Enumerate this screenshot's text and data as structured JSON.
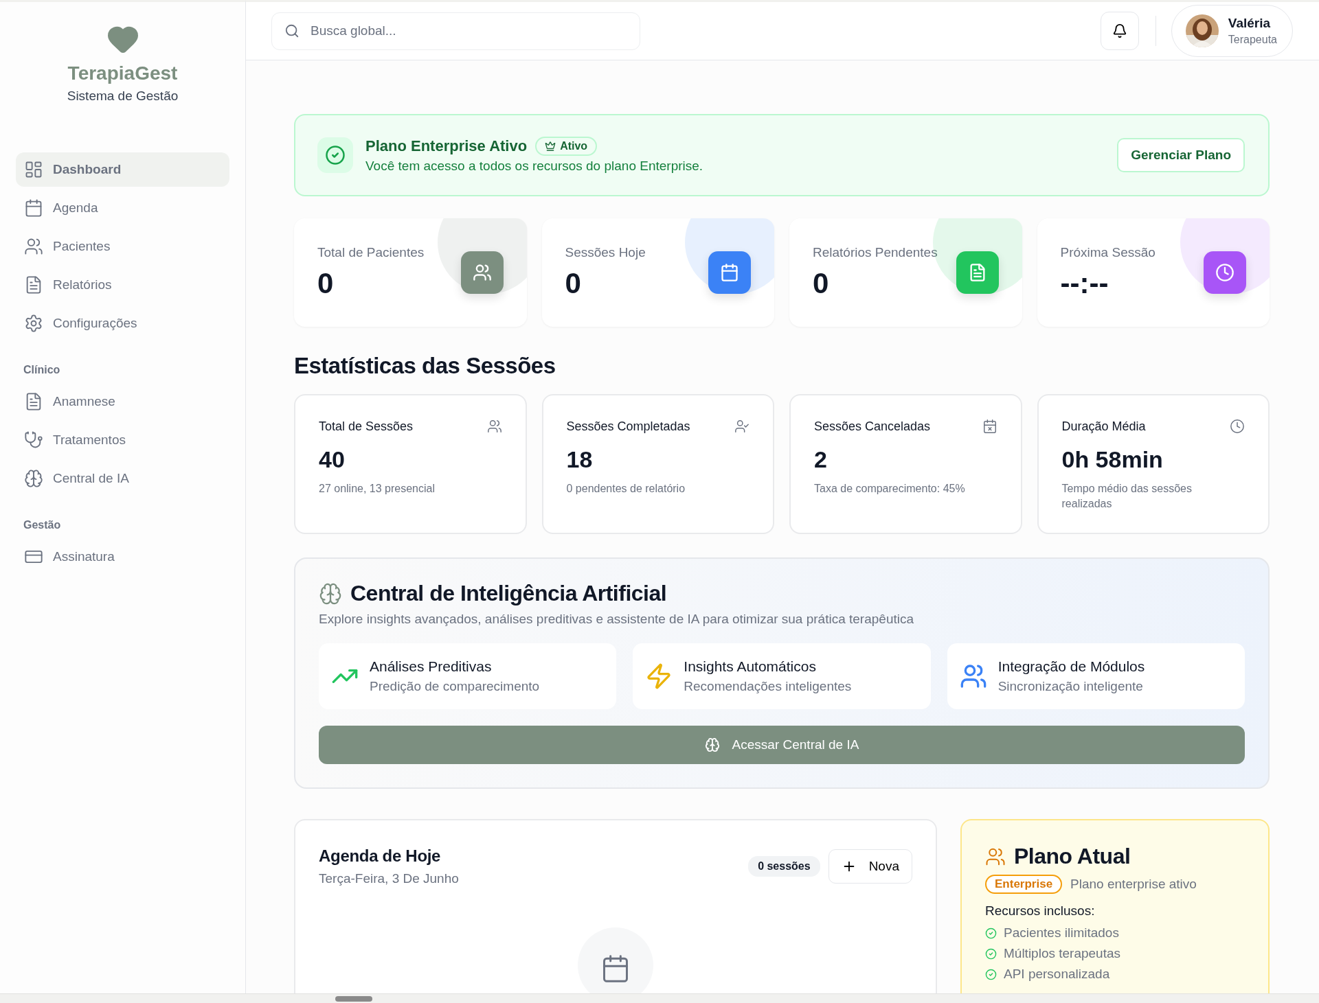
{
  "sidebar": {
    "brand": "TerapiaGest",
    "tagline": "Sistema de Gestão",
    "items": [
      {
        "label": "Dashboard",
        "selected": true
      },
      {
        "label": "Agenda",
        "selected": false
      },
      {
        "label": "Pacientes",
        "selected": false
      },
      {
        "label": "Relatórios",
        "selected": false
      },
      {
        "label": "Configurações",
        "selected": false
      }
    ],
    "sections": [
      {
        "title": "Clínico",
        "items": [
          {
            "label": "Anamnese",
            "selected": false
          },
          {
            "label": "Tratamentos",
            "selected": false
          },
          {
            "label": "Central de IA",
            "selected": false
          }
        ]
      },
      {
        "title": "Gestão",
        "items": [
          {
            "label": "Assinatura",
            "selected": false
          }
        ]
      }
    ]
  },
  "header": {
    "search": {
      "placeholder": "Busca global..."
    },
    "user": {
      "name": "Valéria",
      "role": "Terapeuta"
    }
  },
  "banner": {
    "title": "Plano Enterprise Ativo",
    "badge": "Ativo",
    "text": "Você tem acesso a todos os recursos do plano Enterprise.",
    "button": "Gerenciar Plano"
  },
  "stats": [
    {
      "label": "Total de Pacientes",
      "value": "0",
      "color": "#7c8f80"
    },
    {
      "label": "Sessões Hoje",
      "value": "0",
      "color": "#3b82f6"
    },
    {
      "label": "Relatórios Pendentes",
      "value": "0",
      "color": "#22c55e"
    },
    {
      "label": "Próxima Sessão",
      "value": "--:--",
      "color": "#a855f7"
    }
  ],
  "session_stats": {
    "title": "Estatísticas das Sessões",
    "cards": [
      {
        "title": "Total de Sessões",
        "value": "40",
        "note": "27 online, 13 presencial"
      },
      {
        "title": "Sessões Completadas",
        "value": "18",
        "note": "0 pendentes de relatório"
      },
      {
        "title": "Sessões Canceladas",
        "value": "2",
        "note": "Taxa de comparecimento: 45%"
      },
      {
        "title": "Duração Média",
        "value": "0h 58min",
        "note": "Tempo médio das sessões realizadas"
      }
    ]
  },
  "ai": {
    "title": "Central de Inteligência Artificial",
    "text": "Explore insights avançados, análises preditivas e assistente de IA para otimizar sua prática terapêutica",
    "features": [
      {
        "title": "Análises Preditivas",
        "text": "Predição de comparecimento",
        "color": "#22c55e"
      },
      {
        "title": "Insights Automáticos",
        "text": "Recomendações inteligentes",
        "color": "#eab308"
      },
      {
        "title": "Integração de Módulos",
        "text": "Sincronização inteligente",
        "color": "#3b82f6"
      }
    ],
    "button": "Acessar Central de IA"
  },
  "agenda": {
    "title": "Agenda de Hoje",
    "date": "Terça-Feira, 3 De Junho",
    "count": "0 sessões",
    "button": "Nova"
  },
  "plan": {
    "title": "Plano Atual",
    "badge": "Enterprise",
    "text": "Plano enterprise ativo",
    "features_title": "Recursos inclusos:",
    "features": [
      "Pacientes ilimitados",
      "Múltiplos terapeutas",
      "API personalizada"
    ]
  }
}
